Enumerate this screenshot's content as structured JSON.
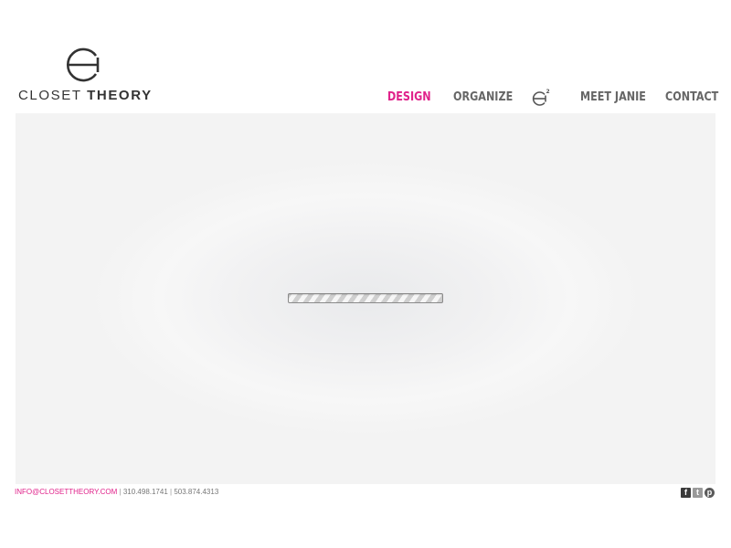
{
  "logo": {
    "word1": "CLOSET",
    "word2": "THEORY"
  },
  "nav": {
    "items": [
      {
        "label": "DESIGN",
        "active": true
      },
      {
        "label": "ORGANIZE",
        "active": false
      },
      {
        "label": "MEET JANIE",
        "active": false
      },
      {
        "label": "CONTACT",
        "active": false
      }
    ],
    "e2_sup": "2"
  },
  "stage": {
    "loading_state": "loading"
  },
  "footer": {
    "email": "INFO@CLOSETTHEORY.COM",
    "separator": "|",
    "phone1": "310.498.1741",
    "phone2": "503.874.4313"
  },
  "social": {
    "facebook": "f",
    "twitter": "t",
    "pinterest": "p"
  },
  "colors": {
    "accent": "#e0218a",
    "nav_text": "#666666",
    "stage_bg": "#f3f3f3"
  }
}
